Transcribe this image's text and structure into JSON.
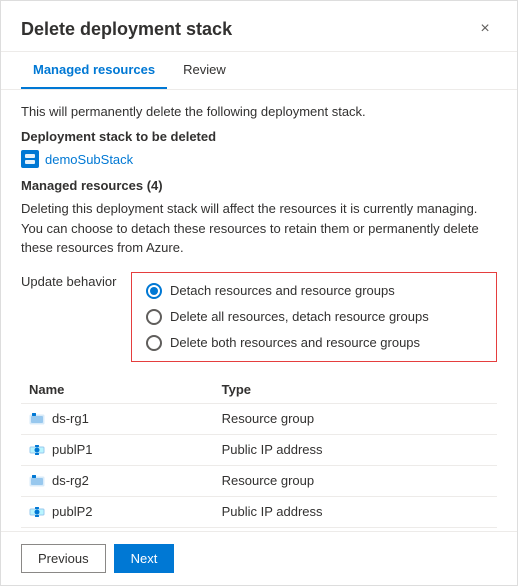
{
  "dialog": {
    "title": "Delete deployment stack",
    "close_label": "×"
  },
  "tabs": [
    {
      "label": "Managed resources",
      "active": true
    },
    {
      "label": "Review",
      "active": false
    }
  ],
  "body": {
    "intro_text": "This will permanently delete the following deployment stack.",
    "stack_section_label": "Deployment stack to be deleted",
    "stack_name": "demoSubStack",
    "managed_resources_label": "Managed resources (4)",
    "warning_text": "Deleting this deployment stack will affect the resources it is currently managing. You can choose to detach these resources to retain them or permanently delete these resources from Azure.",
    "update_behavior_label": "Update behavior",
    "radio_options": [
      {
        "label": "Detach resources and resource groups",
        "selected": true
      },
      {
        "label": "Delete all resources, detach resource groups",
        "selected": false
      },
      {
        "label": "Delete both resources and resource groups",
        "selected": false
      }
    ],
    "table": {
      "columns": [
        "Name",
        "Type"
      ],
      "rows": [
        {
          "name": "ds-rg1",
          "type": "Resource group",
          "icon_type": "rg"
        },
        {
          "name": "publP1",
          "type": "Public IP address",
          "icon_type": "ip"
        },
        {
          "name": "ds-rg2",
          "type": "Resource group",
          "icon_type": "rg"
        },
        {
          "name": "publP2",
          "type": "Public IP address",
          "icon_type": "ip"
        }
      ]
    }
  },
  "footer": {
    "previous_label": "Previous",
    "next_label": "Next"
  }
}
